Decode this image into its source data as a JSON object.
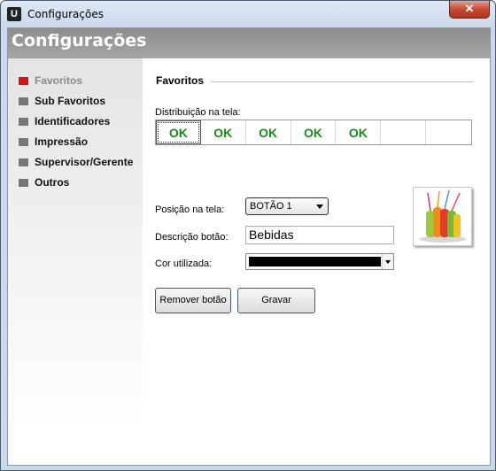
{
  "window": {
    "title": "Configurações",
    "close_label": "✕"
  },
  "header": {
    "title": "Configurações"
  },
  "sidebar": {
    "items": [
      {
        "label": "Favoritos",
        "active": true
      },
      {
        "label": "Sub Favoritos"
      },
      {
        "label": "Identificadores"
      },
      {
        "label": "Impressão"
      },
      {
        "label": "Supervisor/Gerente"
      },
      {
        "label": "Outros"
      }
    ]
  },
  "main": {
    "section_title": "Favoritos",
    "distribution_label": "Distribuição na tela:",
    "slots": [
      "OK",
      "OK",
      "OK",
      "OK",
      "OK",
      "",
      ""
    ],
    "position_label": "Posição na tela:",
    "position_value": "BOTÃO 1",
    "description_label": "Descrição botão:",
    "description_value": "Bebidas",
    "color_label": "Cor utilizada:",
    "color_value": "#000000",
    "remove_button": "Remover botão",
    "save_button": "Gravar"
  },
  "colors": {
    "accent": "#e01010",
    "ok_text": "#1a8a1a",
    "header_band": "#999999"
  }
}
